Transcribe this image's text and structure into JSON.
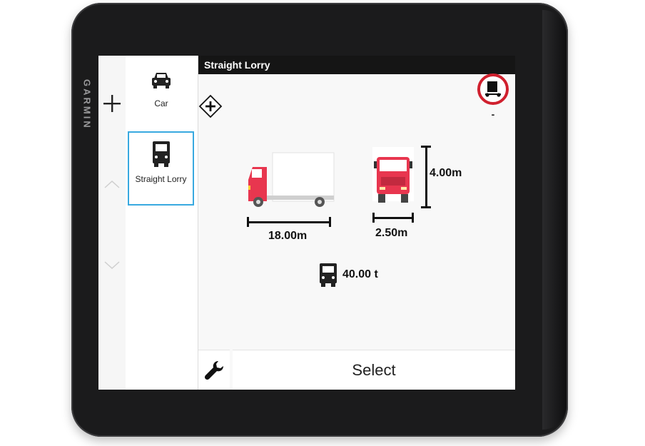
{
  "brand": "GARMIN",
  "profiles": [
    {
      "label": "Car",
      "icon": "car-icon",
      "selected": false
    },
    {
      "label": "Straight Lorry",
      "icon": "lorry-icon",
      "selected": true
    }
  ],
  "detail": {
    "title": "Straight Lorry",
    "length": "18.00m",
    "width": "2.50m",
    "height": "4.00m",
    "weight": "40.00 t",
    "restriction_value": "-",
    "select_label": "Select"
  },
  "colors": {
    "accent": "#38a9e0",
    "truck": "#e8364f",
    "restriction_ring": "#d0202e",
    "titlebar": "#151515"
  }
}
